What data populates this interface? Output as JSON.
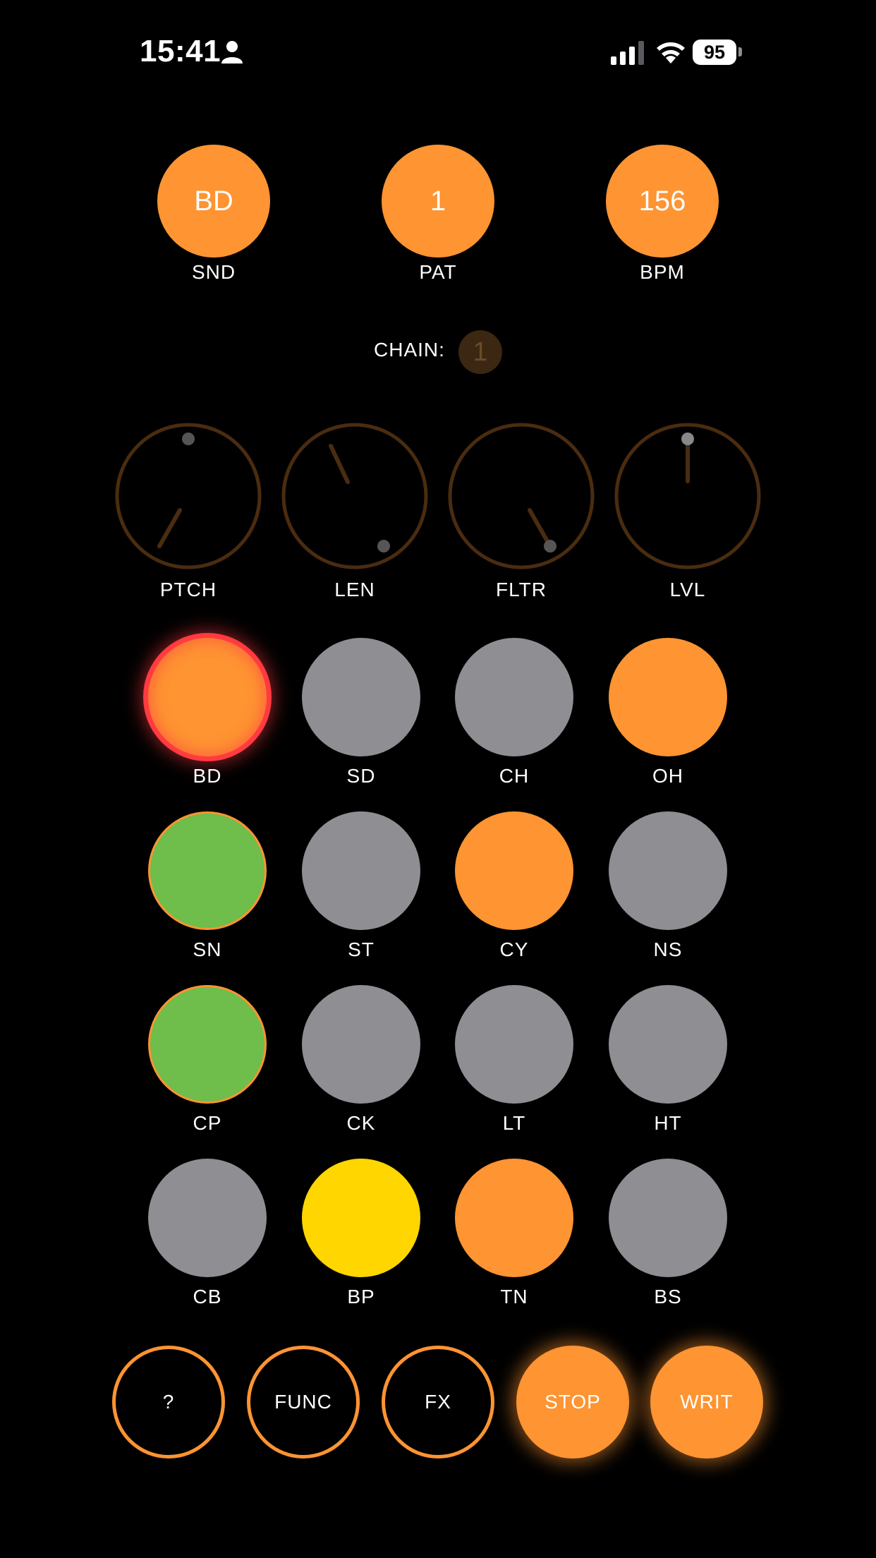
{
  "status_bar": {
    "time": "15:41",
    "battery": "95",
    "icons": [
      "person-icon",
      "cellular-signal-icon",
      "wifi-icon",
      "battery-icon"
    ]
  },
  "selectors": {
    "snd": {
      "value": "BD",
      "label": "SND"
    },
    "pat": {
      "value": "1",
      "label": "PAT"
    },
    "bpm": {
      "value": "156",
      "label": "BPM"
    }
  },
  "chain": {
    "label": "CHAIN:",
    "value": "1"
  },
  "knobs": [
    {
      "label": "PTCH",
      "pointer_angle_deg": 210
    },
    {
      "label": "LEN",
      "pointer_angle_deg": 335
    },
    {
      "label": "FLTR",
      "pointer_angle_deg": 150
    },
    {
      "label": "LVL",
      "pointer_angle_deg": 0
    }
  ],
  "pads": [
    {
      "label": "BD",
      "state": "selected"
    },
    {
      "label": "SD",
      "state": "off"
    },
    {
      "label": "CH",
      "state": "off"
    },
    {
      "label": "OH",
      "state": "on"
    },
    {
      "label": "SN",
      "state": "active"
    },
    {
      "label": "ST",
      "state": "off"
    },
    {
      "label": "CY",
      "state": "on"
    },
    {
      "label": "NS",
      "state": "off"
    },
    {
      "label": "CP",
      "state": "active"
    },
    {
      "label": "CK",
      "state": "off"
    },
    {
      "label": "LT",
      "state": "off"
    },
    {
      "label": "HT",
      "state": "off"
    },
    {
      "label": "CB",
      "state": "off"
    },
    {
      "label": "BP",
      "state": "accent"
    },
    {
      "label": "TN",
      "state": "on"
    },
    {
      "label": "BS",
      "state": "off"
    }
  ],
  "controls": {
    "help": "?",
    "func": "FUNC",
    "fx": "FX",
    "stop": "STOP",
    "write": "WRIT"
  },
  "colors": {
    "orange": "#fe9432",
    "gray": "#8e8e93",
    "green": "#6fbd4b",
    "yellow": "#ffd600",
    "red_ring": "#ff3b40",
    "knob_ring": "#4a2c10"
  }
}
